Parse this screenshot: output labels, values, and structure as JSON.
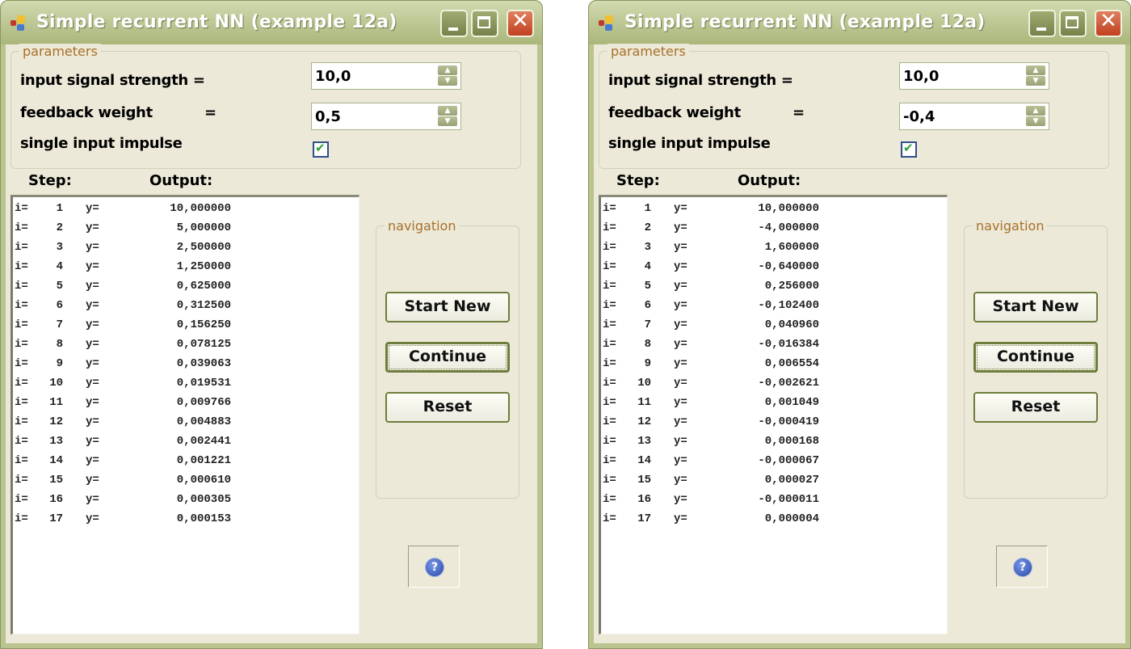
{
  "windows": [
    {
      "title": "Simple recurrent NN (example 12a)",
      "parameters": {
        "legend": "parameters",
        "input_signal_label": "input signal strength =",
        "input_signal_value": "10,0",
        "feedback_weight_label": "feedback weight",
        "feedback_weight_eq": "=",
        "feedback_weight_value": "0,5",
        "single_impulse_label": "single input impulse",
        "single_impulse_checked": true,
        "check_glyph": "✔"
      },
      "columns": {
        "step": "Step:",
        "output": "Output:"
      },
      "rows": [
        {
          "i": "1",
          "y": "10,000000"
        },
        {
          "i": "2",
          "y": "5,000000"
        },
        {
          "i": "3",
          "y": "2,500000"
        },
        {
          "i": "4",
          "y": "1,250000"
        },
        {
          "i": "5",
          "y": "0,625000"
        },
        {
          "i": "6",
          "y": "0,312500"
        },
        {
          "i": "7",
          "y": "0,156250"
        },
        {
          "i": "8",
          "y": "0,078125"
        },
        {
          "i": "9",
          "y": "0,039063"
        },
        {
          "i": "10",
          "y": "0,019531"
        },
        {
          "i": "11",
          "y": "0,009766"
        },
        {
          "i": "12",
          "y": "0,004883"
        },
        {
          "i": "13",
          "y": "0,002441"
        },
        {
          "i": "14",
          "y": "0,001221"
        },
        {
          "i": "15",
          "y": "0,000610"
        },
        {
          "i": "16",
          "y": "0,000305"
        },
        {
          "i": "17",
          "y": "0,000153"
        }
      ],
      "navigation": {
        "legend": "navigation",
        "start_new": "Start New",
        "continue": "Continue",
        "reset": "Reset"
      },
      "help_glyph": "?"
    },
    {
      "title": "Simple recurrent NN (example 12a)",
      "parameters": {
        "legend": "parameters",
        "input_signal_label": "input signal strength =",
        "input_signal_value": "10,0",
        "feedback_weight_label": "feedback weight",
        "feedback_weight_eq": "=",
        "feedback_weight_value": "-0,4",
        "single_impulse_label": "single input impulse",
        "single_impulse_checked": true,
        "check_glyph": "✔"
      },
      "columns": {
        "step": "Step:",
        "output": "Output:"
      },
      "rows": [
        {
          "i": "1",
          "y": "10,000000"
        },
        {
          "i": "2",
          "y": "-4,000000"
        },
        {
          "i": "3",
          "y": "1,600000"
        },
        {
          "i": "4",
          "y": "-0,640000"
        },
        {
          "i": "5",
          "y": "0,256000"
        },
        {
          "i": "6",
          "y": "-0,102400"
        },
        {
          "i": "7",
          "y": "0,040960"
        },
        {
          "i": "8",
          "y": "-0,016384"
        },
        {
          "i": "9",
          "y": "0,006554"
        },
        {
          "i": "10",
          "y": "-0,002621"
        },
        {
          "i": "11",
          "y": "0,001049"
        },
        {
          "i": "12",
          "y": "-0,000419"
        },
        {
          "i": "13",
          "y": "0,000168"
        },
        {
          "i": "14",
          "y": "-0,000067"
        },
        {
          "i": "15",
          "y": "0,000027"
        },
        {
          "i": "16",
          "y": "-0,000011"
        },
        {
          "i": "17",
          "y": "0,000004"
        }
      ],
      "navigation": {
        "legend": "navigation",
        "start_new": "Start New",
        "continue": "Continue",
        "reset": "Reset"
      },
      "help_glyph": "?"
    }
  ],
  "row_labels": {
    "i": "i=",
    "y": "y="
  },
  "titlebar": {
    "minimize_glyph": "",
    "maximize_glyph": "",
    "close_glyph": "✕"
  },
  "colors": {
    "legend_text": "#a8702a",
    "titlebar": "#bfc997",
    "window_bg": "#ece9d8",
    "check": "#2ea02e"
  }
}
